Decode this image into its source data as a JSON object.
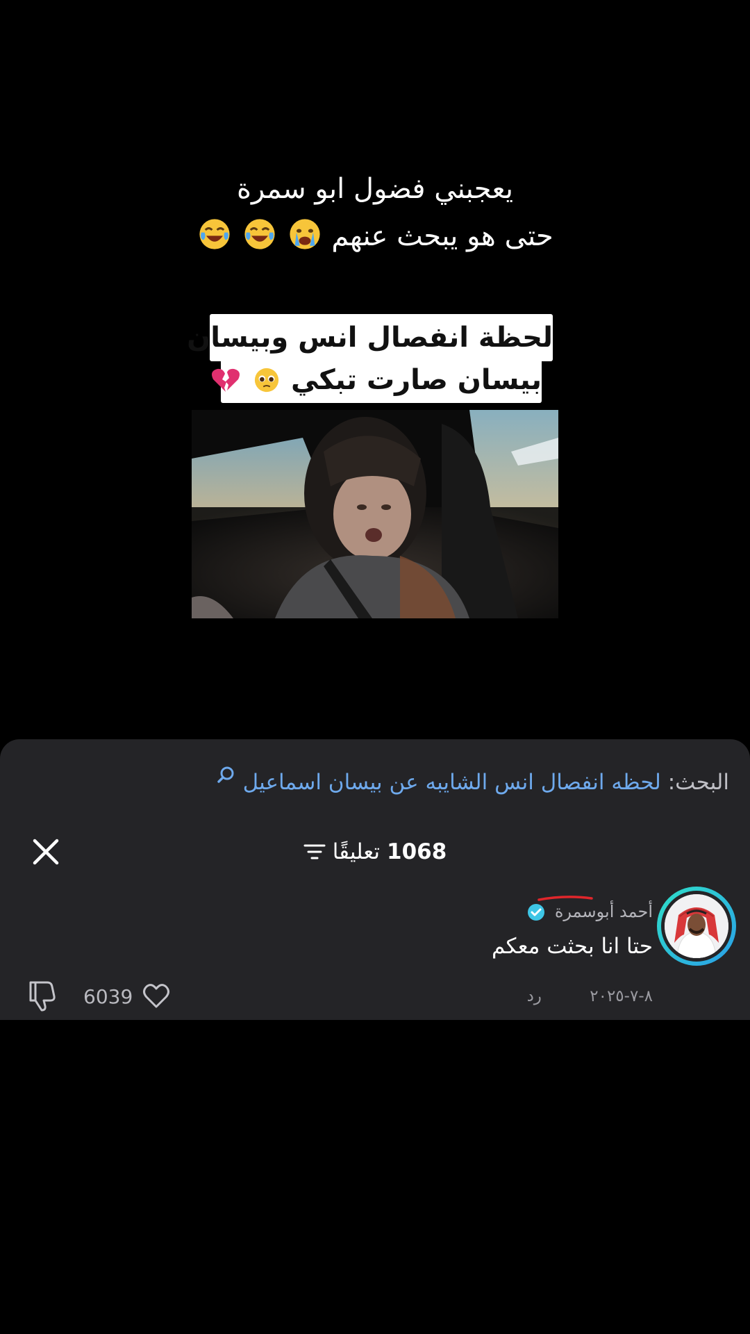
{
  "caption": {
    "line1": "يعجبني فضول ابو سمرة",
    "line2_text": "حتى هو يبحث عنهم",
    "line2_emojis": [
      "crying-face",
      "tears-of-joy",
      "tears-of-joy"
    ]
  },
  "video": {
    "overlay_line1": "لحظة انفصال انس وبيسان",
    "overlay_line2_text": "بيسان صارت تبكي",
    "overlay_line2_emojis": [
      "pleading-face",
      "broken-heart"
    ]
  },
  "comments_sheet": {
    "search_label": "البحث:",
    "search_query": "لحظه انفصال انس الشايبه عن بيسان اسماعيل",
    "comment_count": "1068",
    "comment_count_label": "تعليقًا",
    "icons": {
      "search": "magnifier-icon",
      "filter": "filter-lines-icon",
      "close": "close-x-icon"
    },
    "comment": {
      "author": "أحمد أبوسمرة",
      "verified": true,
      "text": "حتا انا بحثت معكم",
      "date": "٨-٧-٢٠٢٥",
      "reply_label": "رد",
      "likes": "6039"
    }
  },
  "colors": {
    "background": "#000000",
    "sheet": "#242427",
    "link_blue": "#6ea9ec",
    "verified": "#3ec6e6",
    "avatar_ring_start": "#2fe0c8",
    "avatar_ring_end": "#2a9ee8",
    "annotation_red": "#e0262b"
  }
}
